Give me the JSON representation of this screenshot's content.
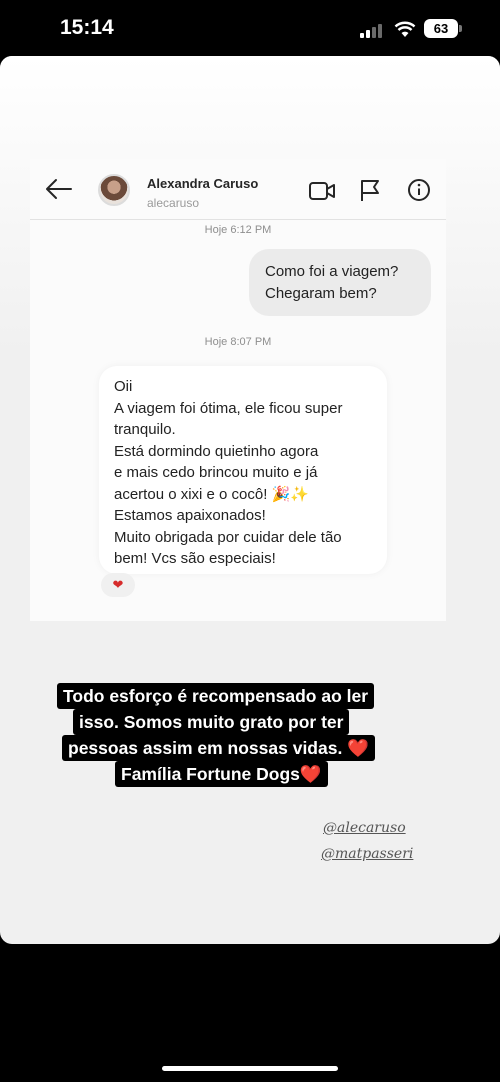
{
  "status_bar": {
    "time": "15:14",
    "battery": "63"
  },
  "chat": {
    "contact_name": "Alexandra Caruso",
    "contact_handle": "alecaruso",
    "timestamp_1": "Hoje 6:12 PM",
    "outgoing_lines": [
      "Como foi a viagem?",
      "Chegaram bem?"
    ],
    "timestamp_2": "Hoje 8:07 PM",
    "incoming_lines": [
      "Oii",
      "A viagem foi ótima, ele ficou super",
      "tranquilo.",
      "Está dormindo quietinho agora",
      "e mais cedo brincou muito e já",
      "acertou o xixi e o cocô! 🎉✨",
      "Estamos apaixonados!",
      "Muito obrigada por cuidar dele tão",
      "bem! Vcs são especiais!"
    ],
    "reaction": "❤"
  },
  "caption": {
    "lines": [
      "Todo esforço é recompensado ao ler",
      "isso. Somos muito grato por ter",
      "pessoas assim em nossas vidas. ❤️",
      "Família Fortune Dogs❤️"
    ]
  },
  "mentions": [
    "@alecaruso",
    "@matpasseri"
  ],
  "colors": {
    "heart": "#e02424",
    "story_bg": "#f0f0f0",
    "bubble_out": "#ebebeb"
  }
}
